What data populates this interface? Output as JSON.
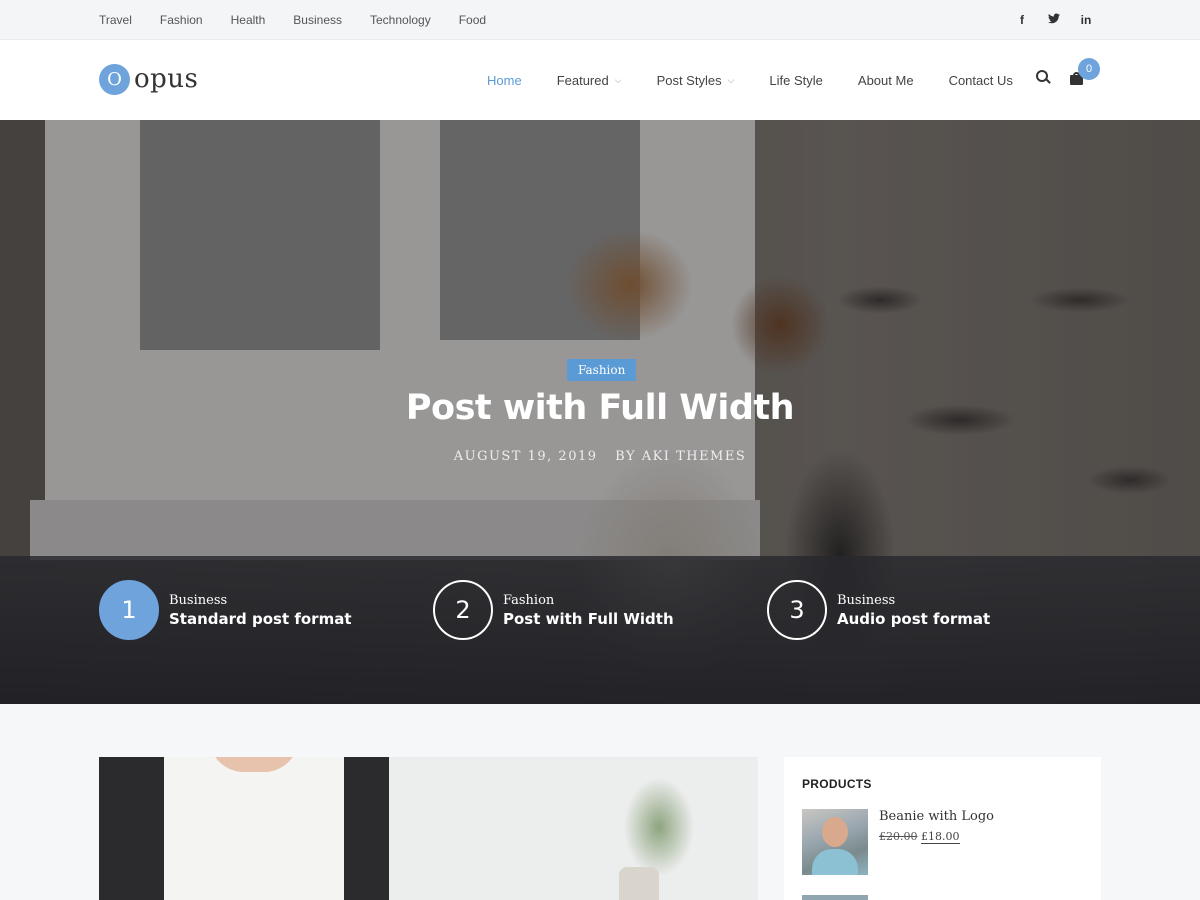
{
  "topbar": {
    "categories": [
      "Travel",
      "Fashion",
      "Health",
      "Business",
      "Technology",
      "Food"
    ],
    "social": [
      {
        "icon": "facebook-icon",
        "glyph": "f"
      },
      {
        "icon": "twitter-icon",
        "glyph": "t"
      },
      {
        "icon": "linkedin-icon",
        "glyph": "in"
      }
    ]
  },
  "header": {
    "logo_mark": "O",
    "logo_text": "opus",
    "nav": {
      "home": "Home",
      "featured": "Featured",
      "post_styles": "Post Styles",
      "life_style": "Life Style",
      "about_me": "About Me",
      "contact_us": "Contact Us"
    },
    "cart_count": "0",
    "accent_color": "#5b9bd5"
  },
  "hero": {
    "category": "Fashion",
    "title": "Post with Full Width",
    "date": "AUGUST 19, 2019",
    "author": "BY AKI THEMES",
    "slides": [
      {
        "number": "1",
        "category": "Business",
        "title": "Standard post format",
        "active": true
      },
      {
        "number": "2",
        "category": "Fashion",
        "title": "Post with Full Width",
        "active": false
      },
      {
        "number": "3",
        "category": "Business",
        "title": "Audio post format",
        "active": false
      }
    ]
  },
  "sidebar": {
    "title": "PRODUCTS",
    "products": [
      {
        "name": "Beanie with Logo",
        "old_price": "£20.00",
        "price": "£18.00"
      }
    ]
  }
}
